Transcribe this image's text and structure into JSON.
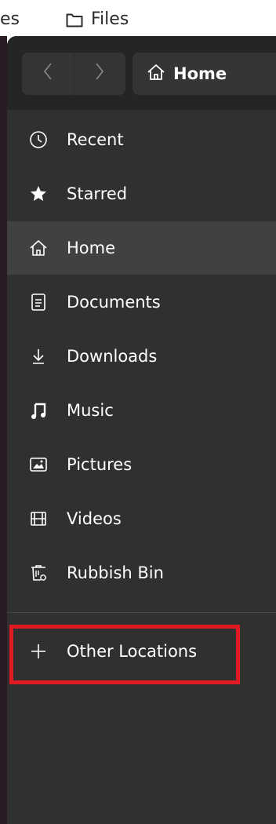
{
  "topbar": {
    "fragment": "es",
    "app_name": "Files"
  },
  "header": {
    "back_label": "〈",
    "forward_label": "〉",
    "path_label": "Home"
  },
  "sidebar": {
    "items": [
      {
        "label": "Recent",
        "icon": "clock-icon"
      },
      {
        "label": "Starred",
        "icon": "star-icon"
      },
      {
        "label": "Home",
        "icon": "home-icon",
        "active": true
      },
      {
        "label": "Documents",
        "icon": "document-icon"
      },
      {
        "label": "Downloads",
        "icon": "download-icon"
      },
      {
        "label": "Music",
        "icon": "music-icon"
      },
      {
        "label": "Pictures",
        "icon": "picture-icon"
      },
      {
        "label": "Videos",
        "icon": "video-icon"
      },
      {
        "label": "Rubbish Bin",
        "icon": "trash-icon"
      }
    ],
    "other_locations": {
      "label": "Other Locations",
      "icon": "plus-icon"
    }
  },
  "colors": {
    "highlight": "#e01a22",
    "sidebar_bg": "#303030",
    "active_bg": "#414141"
  }
}
